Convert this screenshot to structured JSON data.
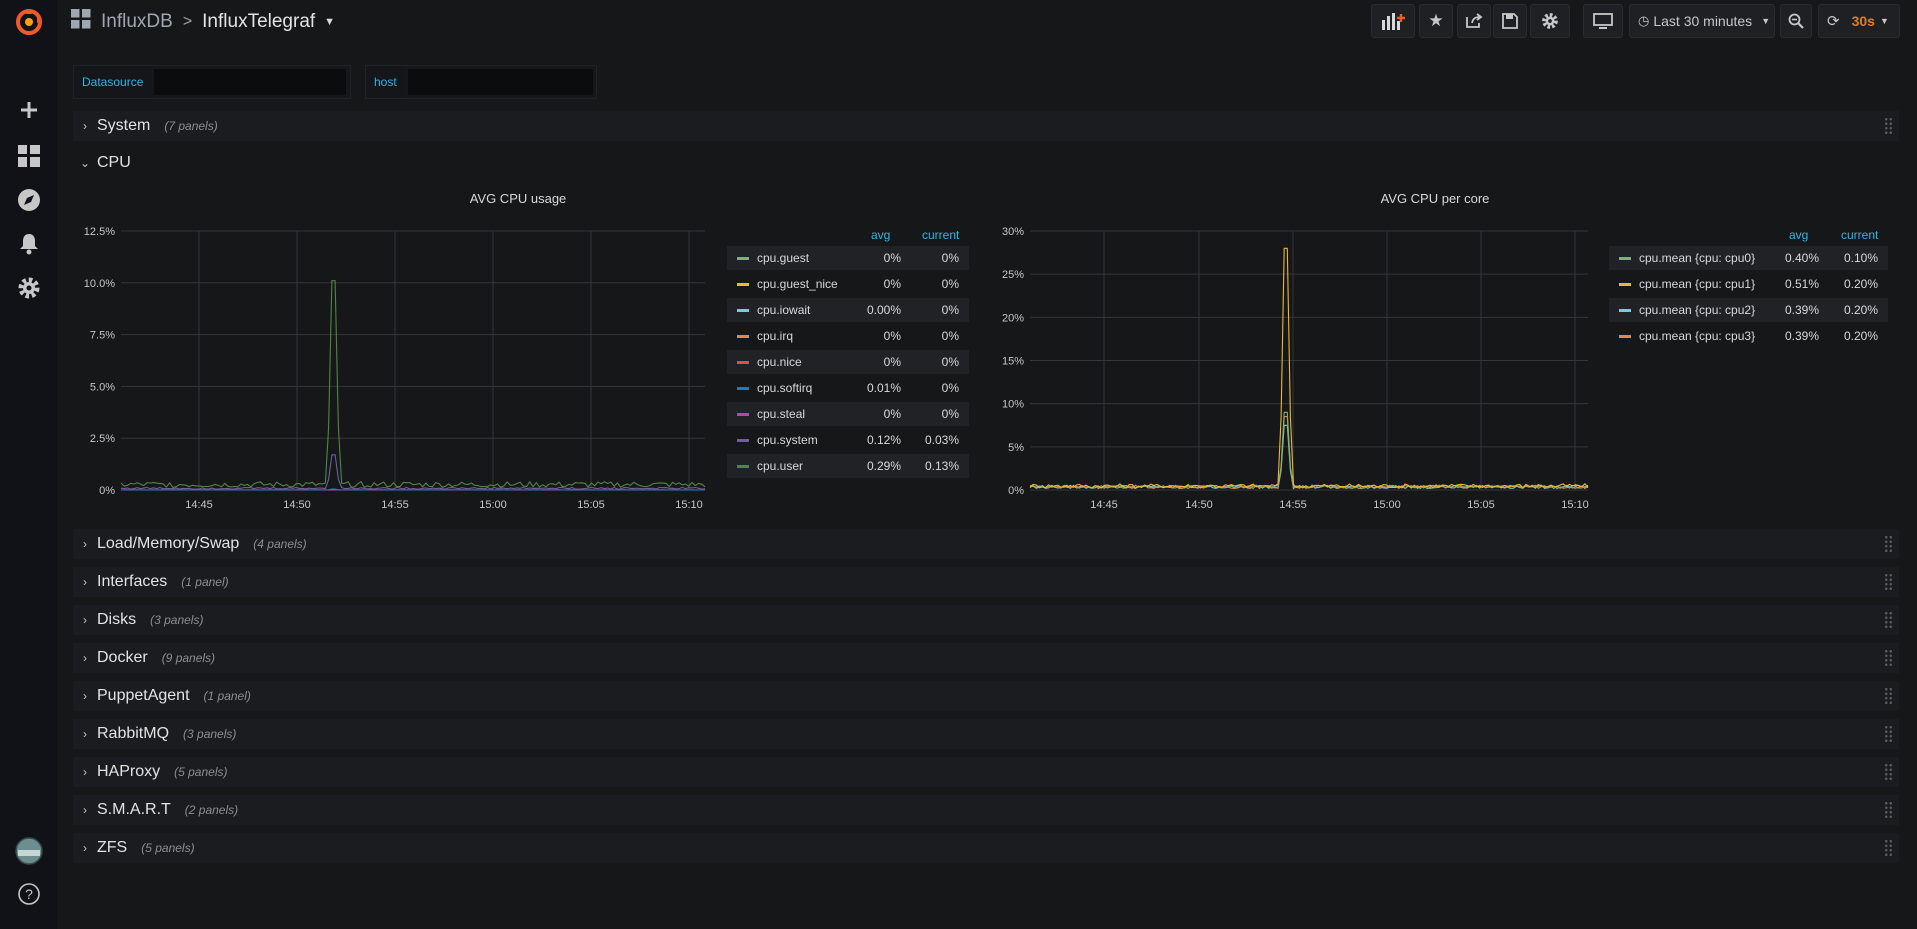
{
  "breadcrumb": {
    "parent": "InfluxDB",
    "separator": ">",
    "title": "InfluxTelegraf"
  },
  "toolbar": {
    "time_range": "Last 30 minutes",
    "refresh_interval": "30s"
  },
  "variables": [
    {
      "label": "Datasource",
      "value": ""
    },
    {
      "label": "host",
      "value": ""
    }
  ],
  "rows_top": [
    {
      "title": "System",
      "count": "(7 panels)"
    }
  ],
  "cpu_row": {
    "title": "CPU"
  },
  "rows_bottom": [
    {
      "title": "Load/Memory/Swap",
      "count": "(4 panels)"
    },
    {
      "title": "Interfaces",
      "count": "(1 panel)"
    },
    {
      "title": "Disks",
      "count": "(3 panels)"
    },
    {
      "title": "Docker",
      "count": "(9 panels)"
    },
    {
      "title": "PuppetAgent",
      "count": "(1 panel)"
    },
    {
      "title": "RabbitMQ",
      "count": "(3 panels)"
    },
    {
      "title": "HAProxy",
      "count": "(5 panels)"
    },
    {
      "title": "S.M.A.R.T",
      "count": "(2 panels)"
    },
    {
      "title": "ZFS",
      "count": "(5 panels)"
    }
  ],
  "colors": {
    "accent": "#33b5e5",
    "refresh": "#eb7b18",
    "background": "#161719"
  },
  "chart_data": [
    {
      "type": "line",
      "title": "AVG CPU usage",
      "x_ticks": [
        "14:45",
        "14:50",
        "14:55",
        "15:00",
        "15:05",
        "15:10"
      ],
      "y_ticks": [
        "0%",
        "2.5%",
        "5.0%",
        "7.5%",
        "10.0%",
        "12.5%"
      ],
      "ylim": [
        0,
        12.5
      ],
      "grid": true,
      "legend_position": "right",
      "legend_headers": {
        "avg": "avg",
        "current": "current"
      },
      "series": [
        {
          "name": "cpu.guest",
          "color": "#7eb26d",
          "avg": "0%",
          "current": "0%",
          "baseline": 0.0,
          "spike": 0.0
        },
        {
          "name": "cpu.guest_nice",
          "color": "#eab839",
          "avg": "0%",
          "current": "0%",
          "baseline": 0.0,
          "spike": 0.0
        },
        {
          "name": "cpu.iowait",
          "color": "#6ed0e0",
          "avg": "0.00%",
          "current": "0%",
          "baseline": 0.0,
          "spike": 0.0
        },
        {
          "name": "cpu.irq",
          "color": "#ef843c",
          "avg": "0%",
          "current": "0%",
          "baseline": 0.0,
          "spike": 0.0
        },
        {
          "name": "cpu.nice",
          "color": "#e24d42",
          "avg": "0%",
          "current": "0%",
          "baseline": 0.0,
          "spike": 0.0
        },
        {
          "name": "cpu.softirq",
          "color": "#1f78c1",
          "avg": "0.01%",
          "current": "0%",
          "baseline": 0.01,
          "spike": 0.05
        },
        {
          "name": "cpu.steal",
          "color": "#ba43a9",
          "avg": "0%",
          "current": "0%",
          "baseline": 0.0,
          "spike": 0.0
        },
        {
          "name": "cpu.system",
          "color": "#705da0",
          "avg": "0.12%",
          "current": "0.03%",
          "baseline": 0.08,
          "spike": 1.7
        },
        {
          "name": "cpu.user",
          "color": "#508642",
          "avg": "0.29%",
          "current": "0.13%",
          "baseline": 0.25,
          "spike": 10.1
        }
      ]
    },
    {
      "type": "line",
      "title": "AVG CPU per core",
      "x_ticks": [
        "14:45",
        "14:50",
        "14:55",
        "15:00",
        "15:05",
        "15:10"
      ],
      "y_ticks": [
        "0%",
        "5%",
        "10%",
        "15%",
        "20%",
        "25%",
        "30%"
      ],
      "ylim": [
        0,
        30
      ],
      "grid": true,
      "legend_position": "right",
      "legend_headers": {
        "avg": "avg",
        "current": "current"
      },
      "series": [
        {
          "name": "cpu.mean {cpu: cpu0}",
          "color": "#7eb26d",
          "avg": "0.40%",
          "current": "0.10%",
          "baseline": 0.35,
          "spike": 9.0
        },
        {
          "name": "cpu.mean {cpu: cpu1}",
          "color": "#eab839",
          "avg": "0.51%",
          "current": "0.20%",
          "baseline": 0.45,
          "spike": 28.0
        },
        {
          "name": "cpu.mean {cpu: cpu2}",
          "color": "#6ed0e0",
          "avg": "0.39%",
          "current": "0.20%",
          "baseline": 0.35,
          "spike": 7.5
        },
        {
          "name": "cpu.mean {cpu: cpu3}",
          "color": "#ef843c",
          "avg": "0.39%",
          "current": "0.20%",
          "baseline": 0.35,
          "spike": 8.5
        }
      ]
    }
  ]
}
